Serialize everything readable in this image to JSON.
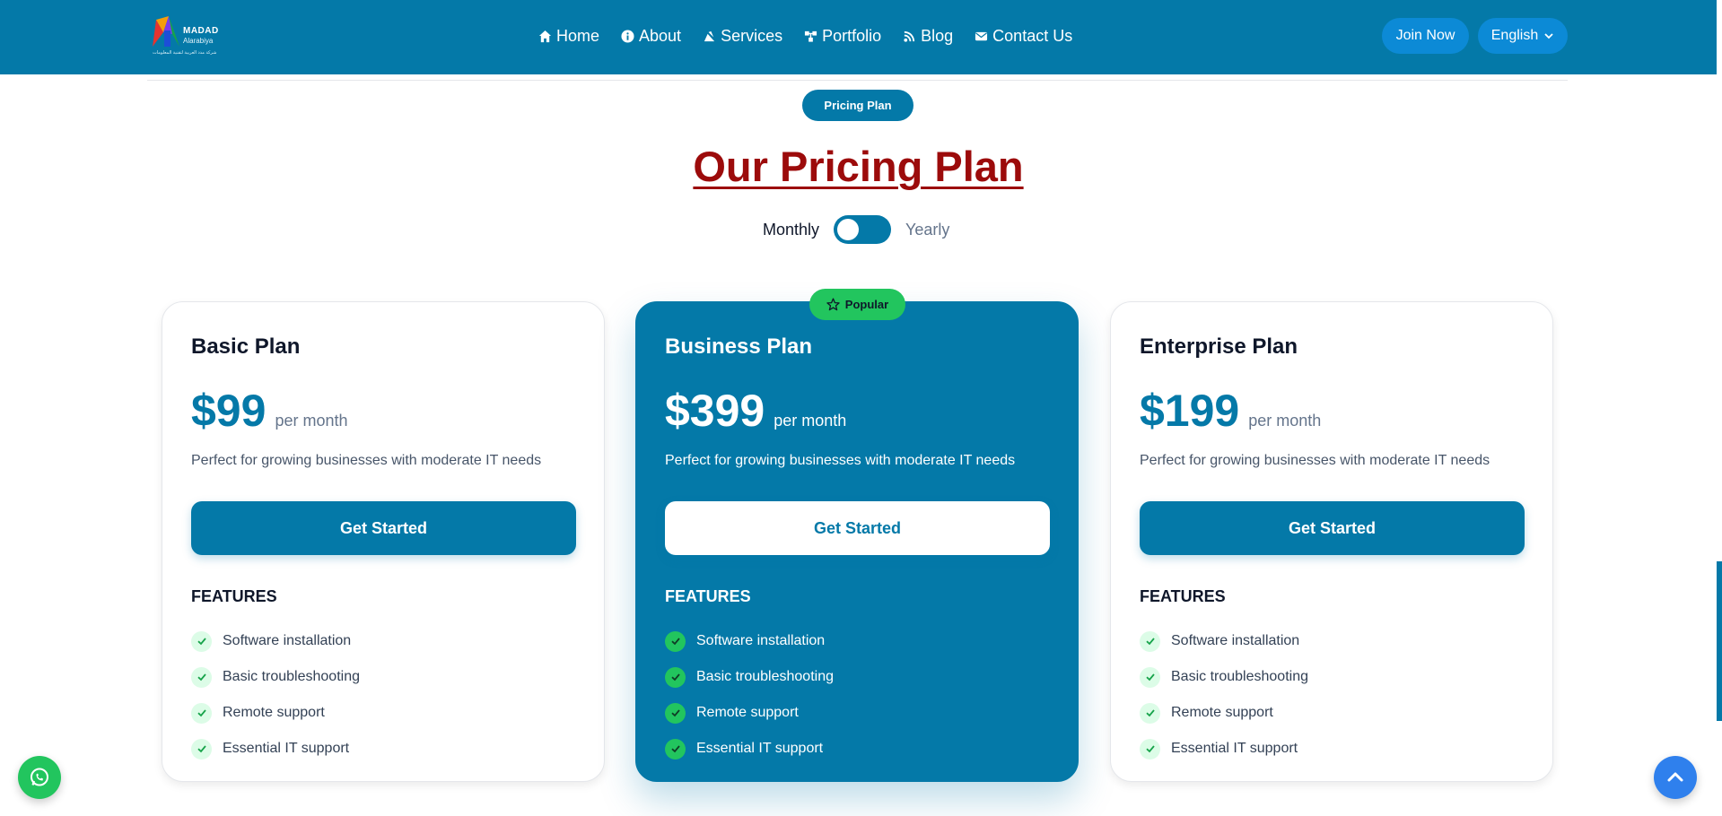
{
  "header": {
    "logo": {
      "name": "MADAD",
      "subname": "Alarabiya",
      "tagline": "شركة مدد العربية لتقنية المعلومات"
    },
    "nav": [
      {
        "label": "Home",
        "icon": "home-icon"
      },
      {
        "label": "About",
        "icon": "info-icon"
      },
      {
        "label": "Services",
        "icon": "services-icon"
      },
      {
        "label": "Portfolio",
        "icon": "portfolio-icon"
      },
      {
        "label": "Blog",
        "icon": "blog-icon"
      },
      {
        "label": "Contact Us",
        "icon": "envelope-icon"
      }
    ],
    "join_label": "Join Now",
    "language_label": "English"
  },
  "section": {
    "badge": "Pricing Plan",
    "title": "Our Pricing Plan",
    "toggle": {
      "left_label": "Monthly",
      "right_label": "Yearly",
      "selected": "Monthly"
    }
  },
  "plans": [
    {
      "name": "Basic Plan",
      "price": "$99",
      "period": "per month",
      "description": "Perfect for growing businesses with moderate IT needs",
      "cta": "Get Started",
      "features_title": "FEATURES",
      "features": [
        "Software installation",
        "Basic troubleshooting",
        "Remote support",
        "Essential IT support"
      ],
      "featured": false
    },
    {
      "name": "Business Plan",
      "price": "$399",
      "period": "per month",
      "description": "Perfect for growing businesses with moderate IT needs",
      "cta": "Get Started",
      "features_title": "FEATURES",
      "features": [
        "Software installation",
        "Basic troubleshooting",
        "Remote support",
        "Essential IT support"
      ],
      "featured": true,
      "badge": "Popular"
    },
    {
      "name": "Enterprise Plan",
      "price": "$199",
      "period": "per month",
      "description": "Perfect for growing businesses with moderate IT needs",
      "cta": "Get Started",
      "features_title": "FEATURES",
      "features": [
        "Software installation",
        "Basic troubleshooting",
        "Remote support",
        "Essential IT support"
      ],
      "featured": false
    }
  ],
  "colors": {
    "primary": "#0479a8",
    "title_red": "#9c0b0b",
    "success": "#22c55e",
    "scroll_button": "#2f80ed"
  },
  "floating": {
    "whatsapp_icon": "whatsapp-icon",
    "scroll_top_icon": "chevron-up-icon"
  }
}
